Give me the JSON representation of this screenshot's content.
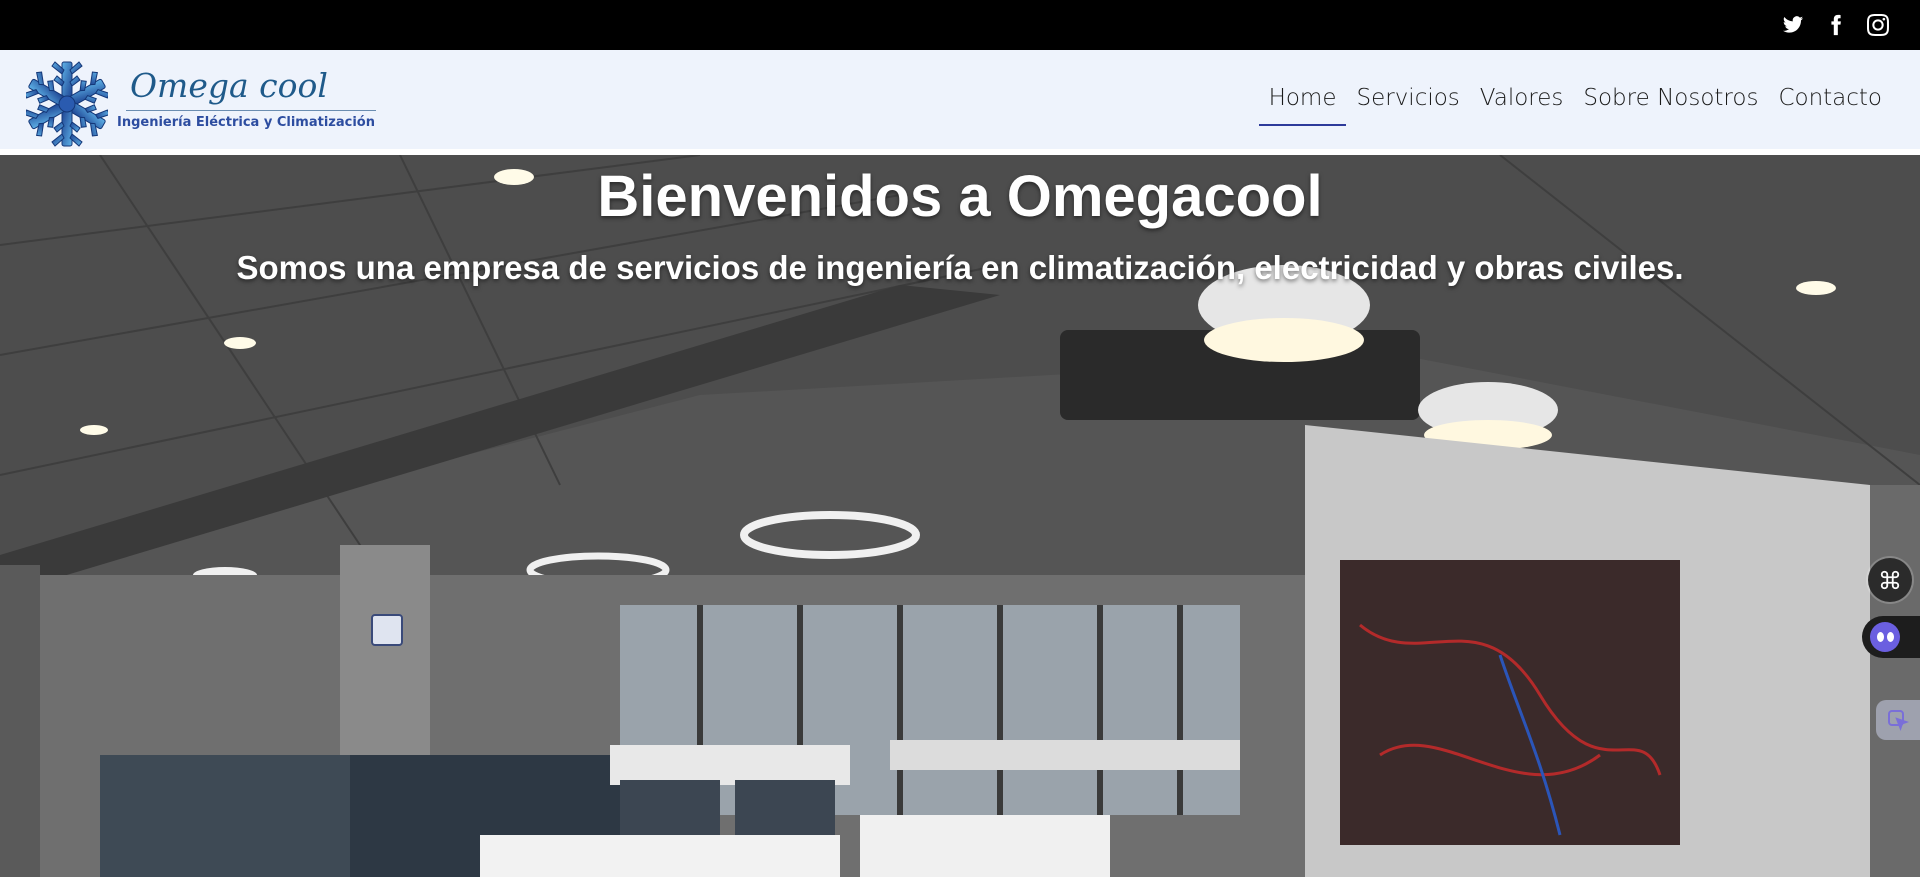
{
  "social": {
    "twitter_icon": "twitter-icon",
    "facebook_icon": "facebook-icon",
    "instagram_icon": "instagram-icon"
  },
  "logo": {
    "name": "Omega cool",
    "tagline": "Ingeniería Eléctrica y Climatización"
  },
  "nav": {
    "items": [
      {
        "label": "Home",
        "active": true
      },
      {
        "label": "Servicios",
        "active": false
      },
      {
        "label": "Valores",
        "active": false
      },
      {
        "label": "Sobre Nosotros",
        "active": false
      },
      {
        "label": "Contacto",
        "active": false
      }
    ]
  },
  "hero": {
    "title": "Bienvenidos a Omegacool",
    "subtitle": "Somos una empresa de servicios de ingeniería en climatización, electricidad y obras civiles."
  },
  "widgets": {
    "grid_icon": "command-icon",
    "bot_icon": "chatbot-icon",
    "pointer_icon": "pointer-icon"
  },
  "colors": {
    "topbar": "#000000",
    "navbar": "#eef3fc",
    "active_underline": "#2d3a9a",
    "logo_blue": "#1f5a8a"
  }
}
